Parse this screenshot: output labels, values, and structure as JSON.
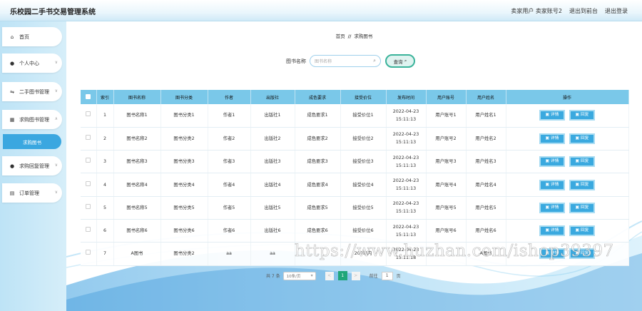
{
  "header": {
    "app_title": "乐校园二手书交易管理系统",
    "user_role": "卖家用户",
    "user_name": "卖家账号2",
    "back_to_front": "退出到前台",
    "logout": "退出登录"
  },
  "sidebar": {
    "items": [
      {
        "label": "首页",
        "icon": "home-icon"
      },
      {
        "label": "个人中心",
        "icon": "user-icon"
      },
      {
        "label": "二手图书管理",
        "icon": "book-icon"
      },
      {
        "label": "求购图书管理",
        "icon": "grid-icon"
      },
      {
        "label": "求购图书",
        "icon": ""
      },
      {
        "label": "求购回复管理",
        "icon": "pin-icon"
      },
      {
        "label": "订单管理",
        "icon": "order-icon"
      }
    ]
  },
  "breadcrumb": {
    "home": "首页",
    "separator": "//",
    "current": "求购图书"
  },
  "search": {
    "label": "图书名称",
    "placeholder": "图书名称",
    "button": "查询"
  },
  "table": {
    "headers": [
      "索引",
      "图书名称",
      "图书分类",
      "作者",
      "出版社",
      "成色要求",
      "接受价位",
      "发布时间",
      "用户账号",
      "用户姓名",
      "操作"
    ],
    "rows": [
      {
        "index": "1",
        "name": "图书名称1",
        "category": "图书分类1",
        "author": "作者1",
        "publisher": "出版社1",
        "condition": "成色要求1",
        "price": "接受价位1",
        "time": "2022-04-23 15:11:13",
        "account": "用户账号1",
        "username": "用户姓名1"
      },
      {
        "index": "2",
        "name": "图书名称2",
        "category": "图书分类2",
        "author": "作者2",
        "publisher": "出版社2",
        "condition": "成色要求2",
        "price": "接受价位2",
        "time": "2022-04-23 15:11:13",
        "account": "用户账号2",
        "username": "用户姓名2"
      },
      {
        "index": "3",
        "name": "图书名称3",
        "category": "图书分类3",
        "author": "作者3",
        "publisher": "出版社3",
        "condition": "成色要求3",
        "price": "接受价位3",
        "time": "2022-04-23 15:11:13",
        "account": "用户账号3",
        "username": "用户姓名3"
      },
      {
        "index": "4",
        "name": "图书名称4",
        "category": "图书分类4",
        "author": "作者4",
        "publisher": "出版社4",
        "condition": "成色要求4",
        "price": "接受价位4",
        "time": "2022-04-23 15:11:13",
        "account": "用户账号4",
        "username": "用户姓名4"
      },
      {
        "index": "5",
        "name": "图书名称5",
        "category": "图书分类5",
        "author": "作者5",
        "publisher": "出版社5",
        "condition": "成色要求5",
        "price": "接受价位5",
        "time": "2022-04-23 15:11:13",
        "account": "用户账号5",
        "username": "用户姓名5"
      },
      {
        "index": "6",
        "name": "图书名称6",
        "category": "图书分类6",
        "author": "作者6",
        "publisher": "出版社6",
        "condition": "成色要求6",
        "price": "接受价位6",
        "time": "2022-04-23 15:11:13",
        "account": "用户账号6",
        "username": "用户姓名6"
      },
      {
        "index": "7",
        "name": "A图书",
        "category": "图书分类2",
        "author": "aa",
        "publisher": "aa",
        "condition": "",
        "price": "200以内",
        "time": "2022-04-23 15:11:18",
        "account": "",
        "username": "A图书"
      }
    ],
    "detail_button": "详情",
    "reply_button": "回复"
  },
  "pagination": {
    "total": "共 7 条",
    "page_size": "10条/页",
    "prev": "<",
    "current_page": "1",
    "next": ">",
    "goto_label": "前往",
    "goto_value": "1",
    "page_unit": "页"
  },
  "watermark": "https://www.huzhan.com/ishop39397",
  "colors": {
    "accent": "#3aa9df",
    "header_bg": "#7ac8e9",
    "pager_active": "#1fa67a",
    "search_btn_border": "#3ab39a"
  }
}
